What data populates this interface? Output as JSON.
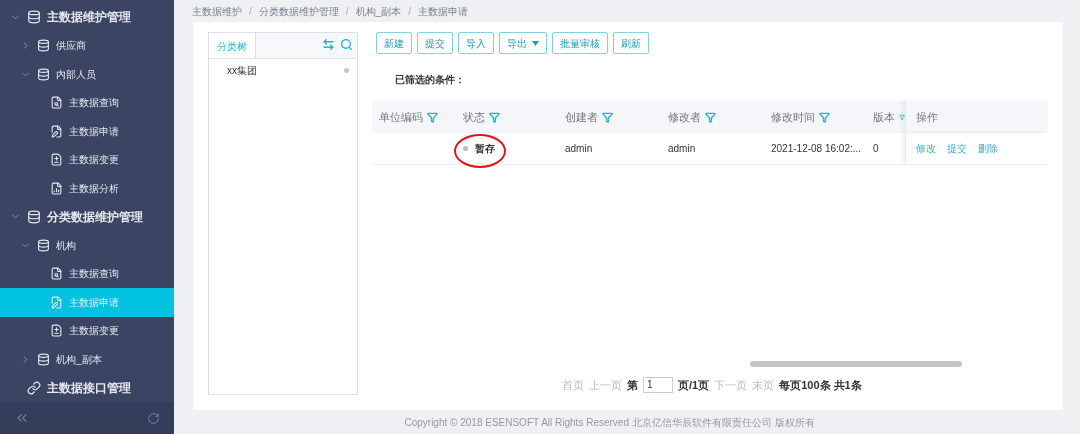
{
  "sidebar": {
    "items": [
      {
        "label": "主数据维护管理",
        "kind": "db-group",
        "expanded": true,
        "selected": false,
        "children": [
          {
            "label": "供应商",
            "kind": "db",
            "expanded": false,
            "selected": false
          },
          {
            "label": "内部人员",
            "kind": "db",
            "expanded": true,
            "selected": false,
            "children": [
              {
                "label": "主数据查询",
                "kind": "query",
                "selected": false
              },
              {
                "label": "主数据申请",
                "kind": "apply",
                "selected": false
              },
              {
                "label": "主数据变更",
                "kind": "change",
                "selected": false
              },
              {
                "label": "主数据分析",
                "kind": "analysis",
                "selected": false
              }
            ]
          }
        ]
      },
      {
        "label": "分类数据维护管理",
        "kind": "db-group",
        "expanded": true,
        "selected": false,
        "children": [
          {
            "label": "机构",
            "kind": "db",
            "expanded": true,
            "selected": false,
            "children": [
              {
                "label": "主数据查询",
                "kind": "query",
                "selected": false
              },
              {
                "label": "主数据申请",
                "kind": "apply",
                "selected": true
              },
              {
                "label": "主数据变更",
                "kind": "change",
                "selected": false
              }
            ]
          },
          {
            "label": "机构_副本",
            "kind": "db",
            "expanded": false,
            "selected": false
          }
        ]
      },
      {
        "label": "主数据接口管理",
        "kind": "link",
        "selected": false
      }
    ]
  },
  "breadcrumb": [
    {
      "kind": "link",
      "text": "主数据维护"
    },
    {
      "kind": "separator",
      "text": "/"
    },
    {
      "kind": "link",
      "text": "分类数据维护管理"
    },
    {
      "kind": "separator",
      "text": "/"
    },
    {
      "kind": "link",
      "text": "机构_副本"
    },
    {
      "kind": "separator",
      "text": "/"
    },
    {
      "kind": "link",
      "text": "主数据申请"
    }
  ],
  "tree_panel": {
    "tab": "分类树",
    "nodes": [
      {
        "label": "xx集团"
      }
    ]
  },
  "toolbar": [
    {
      "label": "新建"
    },
    {
      "label": "提交"
    },
    {
      "label": "导入"
    },
    {
      "label": "导出",
      "dropdown": true
    },
    {
      "label": "批量审核"
    },
    {
      "label": "刷新"
    }
  ],
  "filter_label": "已筛选的条件：",
  "table": {
    "columns": [
      {
        "label": "单位编码",
        "filter": true
      },
      {
        "label": "状态",
        "filter": true
      },
      {
        "label": "创建者",
        "filter": true
      },
      {
        "label": "修改者",
        "filter": true
      },
      {
        "label": "修改时间",
        "filter": true
      },
      {
        "label": "版本",
        "filter": true
      },
      {
        "label": "操作",
        "filter": false
      }
    ],
    "rows": [
      {
        "status": {
          "label": "暂存",
          "color": "#bbbbbb",
          "circled": true
        },
        "creator": "admin",
        "modifier": "admin",
        "modified_time": "2021-12-08 16:02:...",
        "version": "0",
        "actions": [
          "修改",
          "提交",
          "删除"
        ]
      }
    ]
  },
  "pagination": {
    "first": {
      "label": "首页",
      "disabled": true
    },
    "prev": {
      "label": "上一页",
      "disabled": true
    },
    "page_prefix": "第",
    "page": "1",
    "page_suffix": "页/1页",
    "next": {
      "label": "下一页",
      "disabled": true
    },
    "last": {
      "label": "末页",
      "disabled": true
    },
    "summary": "每页100条 共1条"
  },
  "footer": "Copyright © 2018 ESENSOFT All Rights Reserved 北京亿信华辰软件有限责任公司 版权所有"
}
